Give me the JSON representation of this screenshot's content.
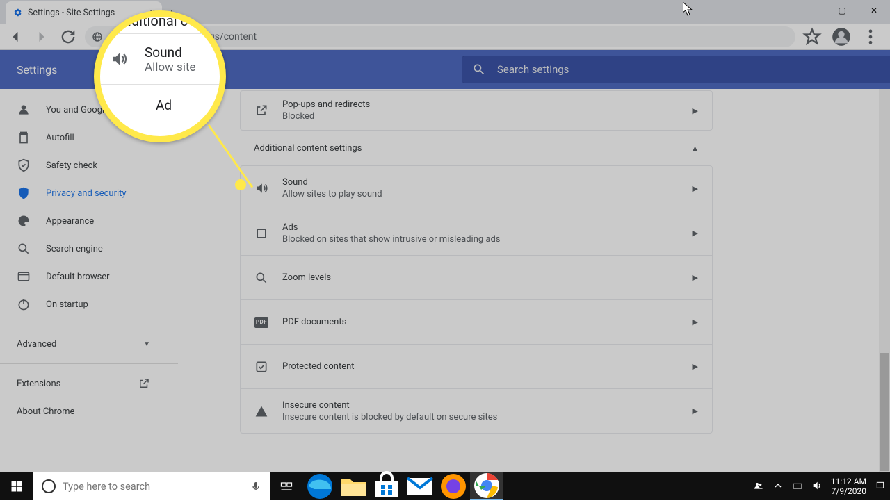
{
  "tab": {
    "title": "Settings - Site Settings"
  },
  "url": "Chrome | chrome://settings/content",
  "url_visible_fragment": "gs/content",
  "window_controls": {
    "min": "—",
    "max": "▢",
    "close": "✕"
  },
  "settings_header": "Settings",
  "search_placeholder": "Search settings",
  "sidebar": {
    "items": [
      {
        "label": "You and Google",
        "icon": "person"
      },
      {
        "label": "Autofill",
        "icon": "autofill"
      },
      {
        "label": "Safety check",
        "icon": "shield-check"
      },
      {
        "label": "Privacy and security",
        "icon": "shield",
        "active": true
      },
      {
        "label": "Appearance",
        "icon": "palette"
      },
      {
        "label": "Search engine",
        "icon": "search"
      },
      {
        "label": "Default browser",
        "icon": "browser"
      },
      {
        "label": "On startup",
        "icon": "power"
      }
    ],
    "advanced": "Advanced",
    "extensions": "Extensions",
    "about": "About Chrome"
  },
  "content": {
    "popups": {
      "title": "Pop-ups and redirects",
      "sub": "Blocked"
    },
    "section": "Additional content settings",
    "rows": [
      {
        "key": "sound",
        "title": "Sound",
        "sub": "Allow sites to play sound",
        "icon": "volume"
      },
      {
        "key": "ads",
        "title": "Ads",
        "sub": "Blocked on sites that show intrusive or misleading ads",
        "icon": "crop"
      },
      {
        "key": "zoom",
        "title": "Zoom levels",
        "sub": "",
        "icon": "search"
      },
      {
        "key": "pdf",
        "title": "PDF documents",
        "sub": "",
        "icon": "pdf"
      },
      {
        "key": "protected",
        "title": "Protected content",
        "sub": "",
        "icon": "check-box"
      },
      {
        "key": "insecure",
        "title": "Insecure content",
        "sub": "Insecure content is blocked by default on secure sites",
        "icon": "warning"
      }
    ]
  },
  "magnifier": {
    "top_fragment": "iditional c",
    "title": "Sound",
    "sub": "Allow site",
    "bottom_fragment": "Ad"
  },
  "taskbar": {
    "search_placeholder": "Type here to search",
    "time": "11:12 AM",
    "date": "7/9/2020"
  },
  "pdf_badge": "PDF"
}
